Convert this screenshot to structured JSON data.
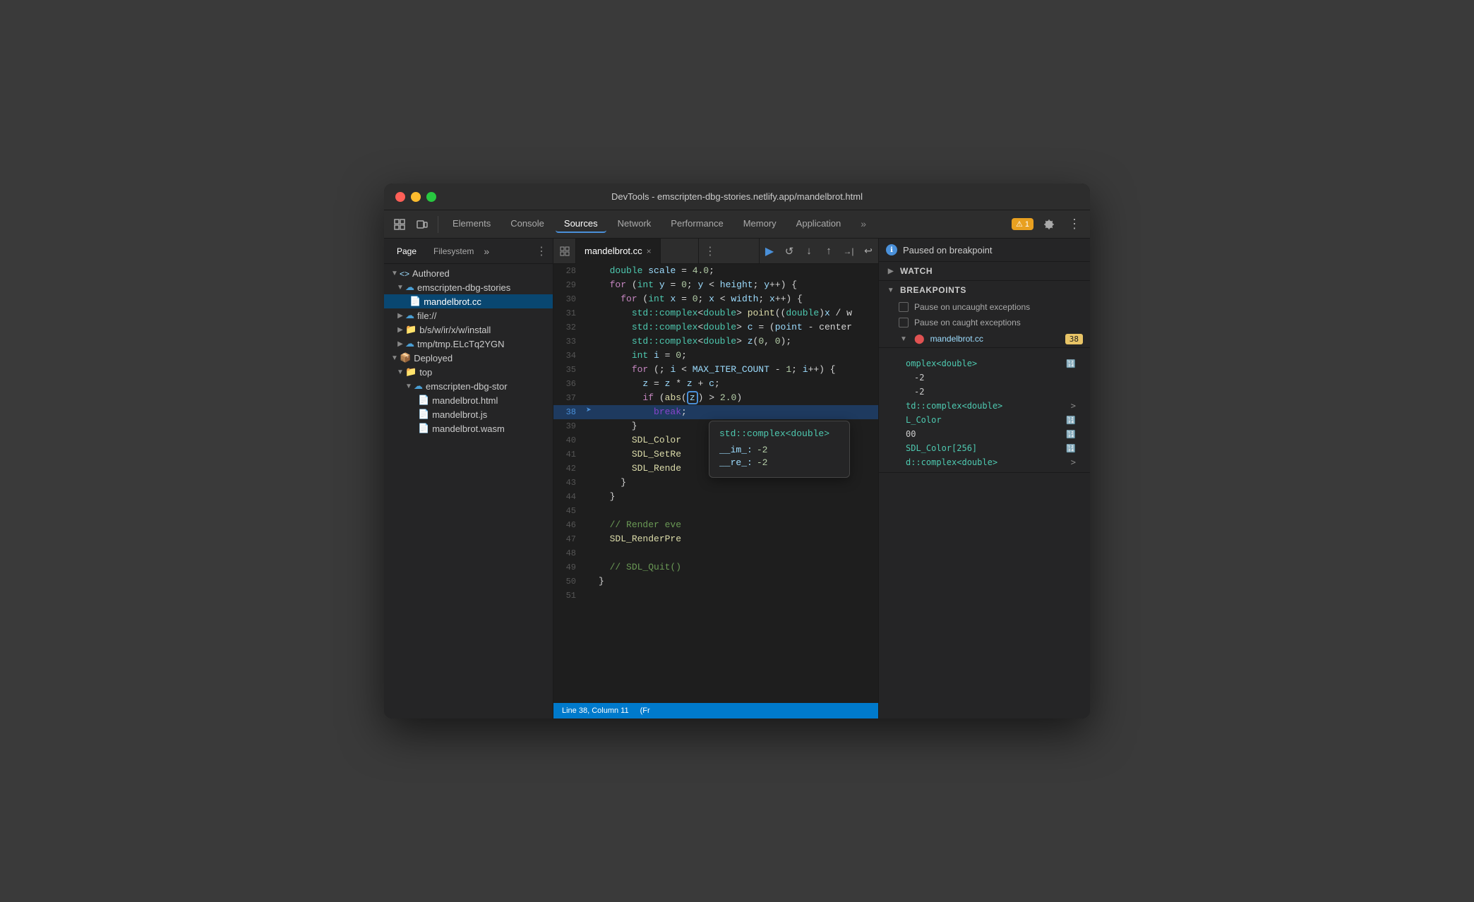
{
  "window": {
    "title": "DevTools - emscripten-dbg-stories.netlify.app/mandelbrot.html",
    "traffic_lights": [
      "red",
      "yellow",
      "green"
    ]
  },
  "toolbar": {
    "icons": [
      "inspect",
      "device"
    ],
    "tabs": [
      "Elements",
      "Console",
      "Sources",
      "Network",
      "Performance",
      "Memory",
      "Application"
    ],
    "active_tab": "Sources",
    "more_label": "»",
    "warning": "⚠ 1",
    "settings_label": "⚙",
    "dots_label": "⋮"
  },
  "file_panel": {
    "tabs": [
      "Page",
      "Filesystem"
    ],
    "more": "»",
    "dots": "⋮",
    "tree": [
      {
        "label": "<> Authored",
        "indent": 0,
        "type": "group",
        "arrow": "▼"
      },
      {
        "label": "emscripten-dbg-stories",
        "indent": 1,
        "type": "cloud",
        "arrow": "▼"
      },
      {
        "label": "mandelbrot.cc",
        "indent": 2,
        "type": "file",
        "selected": true
      },
      {
        "label": "file://",
        "indent": 1,
        "type": "cloud",
        "arrow": "▶"
      },
      {
        "label": "b/s/w/ir/x/w/install",
        "indent": 1,
        "type": "folder",
        "arrow": "▶"
      },
      {
        "label": "tmp/tmp.ELcTq2YGN",
        "indent": 1,
        "type": "cloud",
        "arrow": "▶"
      },
      {
        "label": "Deployed",
        "indent": 0,
        "type": "group",
        "arrow": "▼"
      },
      {
        "label": "top",
        "indent": 1,
        "type": "folder",
        "arrow": "▼"
      },
      {
        "label": "emscripten-dbg-stor",
        "indent": 2,
        "type": "cloud",
        "arrow": "▼"
      },
      {
        "label": "mandelbrot.html",
        "indent": 3,
        "type": "file"
      },
      {
        "label": "mandelbrot.js",
        "indent": 3,
        "type": "file"
      },
      {
        "label": "mandelbrot.wasm",
        "indent": 3,
        "type": "file"
      }
    ]
  },
  "editor": {
    "file_name": "mandelbrot.cc",
    "lines": [
      {
        "num": 28,
        "content": "  double scale = 4.0;",
        "highlight": false
      },
      {
        "num": 29,
        "content": "  for (int y = 0; y < height; y++) {",
        "highlight": false
      },
      {
        "num": 30,
        "content": "    for (int x = 0; x < width; x++) {",
        "highlight": false
      },
      {
        "num": 31,
        "content": "      std::complex<double> point((double)x / w",
        "highlight": false
      },
      {
        "num": 32,
        "content": "      std::complex<double> c = (point - center",
        "highlight": false
      },
      {
        "num": 33,
        "content": "      std::complex<double> z(0, 0);",
        "highlight": false
      },
      {
        "num": 34,
        "content": "      int i = 0;",
        "highlight": false
      },
      {
        "num": 35,
        "content": "      for (; i < MAX_ITER_COUNT - 1; i++) {",
        "highlight": false
      },
      {
        "num": 36,
        "content": "        z = z * z + c;",
        "highlight": false
      },
      {
        "num": 37,
        "content": "        if (abs(z) > 2.0)",
        "highlight": false
      },
      {
        "num": 38,
        "content": "          break;",
        "highlight": true,
        "breakpoint": true,
        "current": true
      },
      {
        "num": 39,
        "content": "      }",
        "highlight": false
      },
      {
        "num": 40,
        "content": "      SDL_Color",
        "highlight": false
      },
      {
        "num": 41,
        "content": "      SDL_SetRe",
        "highlight": false
      },
      {
        "num": 42,
        "content": "      SDL_Rende",
        "highlight": false
      },
      {
        "num": 43,
        "content": "    }",
        "highlight": false
      },
      {
        "num": 44,
        "content": "  }",
        "highlight": false
      },
      {
        "num": 45,
        "content": "",
        "highlight": false
      },
      {
        "num": 46,
        "content": "  // Render eve",
        "highlight": false
      },
      {
        "num": 47,
        "content": "  SDL_RenderPre",
        "highlight": false
      },
      {
        "num": 48,
        "content": "",
        "highlight": false
      },
      {
        "num": 49,
        "content": "  // SDL_Quit()",
        "highlight": false
      },
      {
        "num": 50,
        "content": "}",
        "highlight": false
      },
      {
        "num": 51,
        "content": "",
        "highlight": false
      }
    ],
    "tooltip": {
      "title": "std::complex<double>",
      "fields": [
        {
          "key": "__im_:",
          "value": "-2"
        },
        {
          "key": "__re_:",
          "value": "-2"
        }
      ]
    },
    "status": {
      "line": "Line 38, Column 11",
      "frame": "(Fr"
    }
  },
  "debugger": {
    "buttons": [
      "▶",
      "↺",
      "↓",
      "↑",
      "→|",
      "↩"
    ],
    "paused_text": "Paused on breakpoint",
    "sections": {
      "watch": {
        "label": "Watch",
        "arrow": "▶"
      },
      "breakpoints": {
        "label": "Breakpoints",
        "arrow": "▼",
        "items": [
          {
            "label": "Pause on uncaught exceptions"
          },
          {
            "label": "Pause on caught exceptions"
          }
        ],
        "file": "mandelbrot.cc",
        "line_num": "38"
      }
    },
    "scope_items": [
      {
        "key": "",
        "type": "omplex<double>",
        "icon": "🔢",
        "indent": 0
      },
      {
        "key": "",
        "val": "-2",
        "indent": 1
      },
      {
        "key": "",
        "val": "-2",
        "indent": 1
      },
      {
        "key": "",
        "type": "td::complex<double>",
        "icon": "",
        "indent": 0
      },
      {
        "key": "",
        "type": "L_Color",
        "icon": "🔢",
        "indent": 0
      },
      {
        "key": "",
        "val": "00",
        "icon": "🔢",
        "indent": 0
      },
      {
        "key": "",
        "type": "SDL_Color[256]",
        "icon": "🔢",
        "indent": 0
      },
      {
        "key": "",
        "type": "d::complex<double>",
        "icon": "",
        "indent": 0
      }
    ]
  }
}
